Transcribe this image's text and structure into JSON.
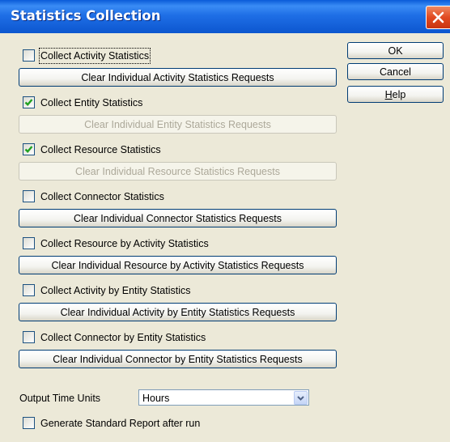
{
  "window": {
    "title": "Statistics Collection"
  },
  "buttons": {
    "ok": "OK",
    "cancel": "Cancel",
    "help": "Help"
  },
  "stats": [
    {
      "checkbox_label": "Collect Activity Statistics",
      "checked": false,
      "clear_label": "Clear Individual Activity Statistics Requests",
      "clear_enabled": true
    },
    {
      "checkbox_label": "Collect Entity Statistics",
      "checked": true,
      "clear_label": "Clear Individual Entity Statistics Requests",
      "clear_enabled": false
    },
    {
      "checkbox_label": "Collect Resource Statistics",
      "checked": true,
      "clear_label": "Clear Individual Resource Statistics Requests",
      "clear_enabled": false
    },
    {
      "checkbox_label": "Collect Connector Statistics",
      "checked": false,
      "clear_label": "Clear Individual Connector Statistics Requests",
      "clear_enabled": true
    },
    {
      "checkbox_label": "Collect Resource by Activity Statistics",
      "checked": false,
      "clear_label": "Clear Individual Resource by Activity Statistics Requests",
      "clear_enabled": true
    },
    {
      "checkbox_label": "Collect Activity by Entity Statistics",
      "checked": false,
      "clear_label": "Clear Individual Activity by Entity Statistics Requests",
      "clear_enabled": true
    },
    {
      "checkbox_label": "Collect Connector by Entity Statistics",
      "checked": false,
      "clear_label": "Clear Individual Connector by Entity Statistics Requests",
      "clear_enabled": true
    }
  ],
  "output_units": {
    "label": "Output Time Units",
    "value": "Hours"
  },
  "report": {
    "label": "Generate Standard Report after run",
    "checked": false
  }
}
